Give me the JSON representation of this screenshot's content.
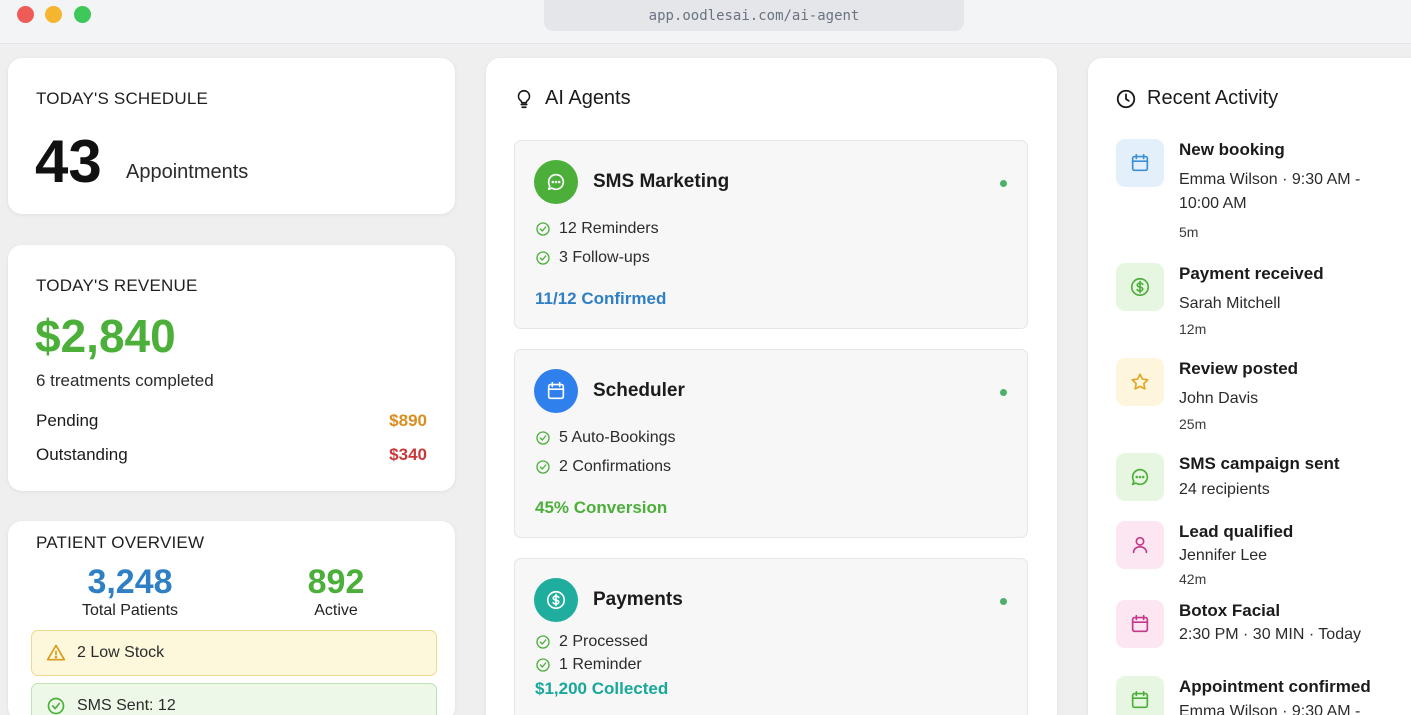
{
  "browser": {
    "url": "app.oodlesai.com/ai-agent"
  },
  "schedule": {
    "label": "TODAY'S SCHEDULE",
    "count": "43",
    "unit": "Appointments"
  },
  "revenue": {
    "label": "TODAY'S REVENUE",
    "amount": "$2,840",
    "sub": "6 treatments completed",
    "pending_label": "Pending",
    "pending_value": "$890",
    "outstanding_label": "Outstanding",
    "outstanding_value": "$340"
  },
  "patients": {
    "label": "PATIENT OVERVIEW",
    "total_value": "3,248",
    "total_label": "Total Patients",
    "active_value": "892",
    "active_label": "Active",
    "low_stock": "2 Low Stock",
    "sms_sent": "SMS Sent: 12"
  },
  "agents": {
    "title": "AI Agents",
    "items": [
      {
        "name": "SMS Marketing",
        "line1": "12 Reminders",
        "line2": "3 Follow-ups",
        "metric": "11/12 Confirmed",
        "color": "#4caf3a",
        "metric_color": "#2f7fc4"
      },
      {
        "name": "Scheduler",
        "line1": "5 Auto-Bookings",
        "line2": "2 Confirmations",
        "metric": "45% Conversion",
        "color": "#2f80ed",
        "metric_color": "#4caf3a"
      },
      {
        "name": "Payments",
        "line1": "2 Processed",
        "line2": "1 Reminder",
        "metric": "$1,200 Collected",
        "color": "#1fae9e",
        "metric_color": "#18a89a"
      }
    ]
  },
  "activity": {
    "title": "Recent Activity",
    "items": [
      {
        "title": "New booking",
        "detail": "Emma Wilson · 9:30 AM - 10:00 AM",
        "time": "5m",
        "icon": "calendar-icon"
      },
      {
        "title": "Payment received",
        "detail": "Sarah Mitchell",
        "time": "12m",
        "icon": "dollar-icon"
      },
      {
        "title": "Review posted",
        "detail": "John Davis",
        "time": "25m",
        "icon": "star-icon"
      },
      {
        "title": "SMS campaign sent",
        "detail": "24 recipients",
        "time": "",
        "icon": "message-icon"
      },
      {
        "title": "Lead qualified",
        "detail": "Jennifer Lee",
        "time": "42m",
        "icon": "user-icon"
      },
      {
        "title": "Botox Facial",
        "detail": "2:30 PM · 30 MIN · Today",
        "time": "",
        "icon": "calendar-icon"
      },
      {
        "title": "Appointment confirmed",
        "detail": "Emma Wilson · 9:30 AM -",
        "time": "",
        "icon": "calendar-icon"
      }
    ]
  }
}
